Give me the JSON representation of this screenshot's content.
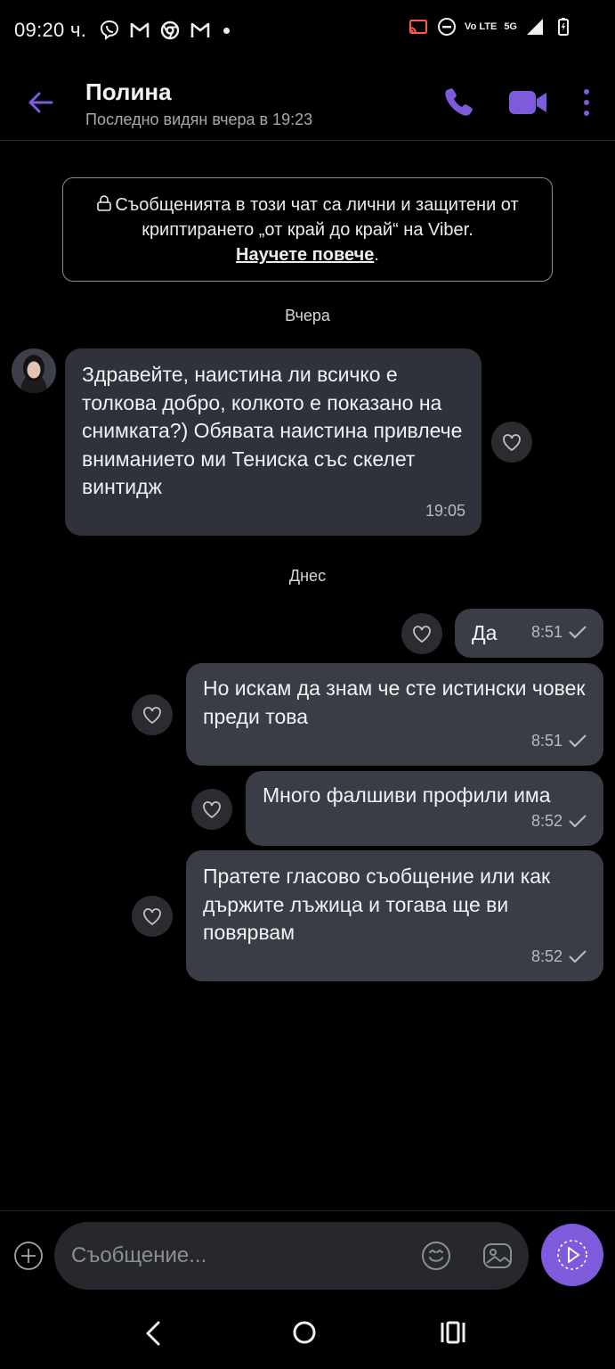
{
  "status_bar": {
    "time": "09:20 ч.",
    "volte": "Vo LTE",
    "network": "5G"
  },
  "header": {
    "name": "Полина",
    "last_seen": "Последно видян вчера в 19:23"
  },
  "notice": {
    "text": "Съобщенията в този чат са лични и защитени от криптирането „от край до край“ на Viber.",
    "link": "Научете повече",
    "end": "."
  },
  "dates": {
    "yesterday": "Вчера",
    "today": "Днес"
  },
  "messages": [
    {
      "direction": "in",
      "text": "Здравейте, наистина ли всичко е толкова добро, колкото е показано на снимката?) Обявата наистина привлече вниманието ми Тениска със скелет винтидж",
      "time": "19:05"
    },
    {
      "direction": "out",
      "text": "Да",
      "time": "8:51"
    },
    {
      "direction": "out",
      "text": "Но искам да знам че сте истински човек преди това",
      "time": "8:51"
    },
    {
      "direction": "out",
      "text": "Много фалшиви профили има",
      "time": "8:52"
    },
    {
      "direction": "out",
      "text": "Пратете гласово съобщение или как държите лъжица и тогава ще ви повярвам",
      "time": "8:52"
    }
  ],
  "composer": {
    "placeholder": "Съобщение..."
  },
  "colors": {
    "accent": "#7d5bdb",
    "bubble_in": "#2f323a",
    "bubble_out": "#3a3d45",
    "background": "#000000"
  }
}
